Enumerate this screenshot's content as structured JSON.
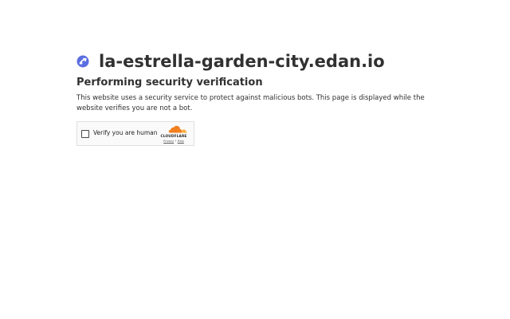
{
  "site": {
    "name": "la-estrella-garden-city.edan.io",
    "favicon_icon": "edan-logo-icon"
  },
  "main": {
    "heading": "Performing security verification",
    "description": "This website uses a security service to protect against malicious bots. This page is displayed while the website verifies you are not a bot."
  },
  "widget": {
    "checkbox_label": "Verify you are human",
    "checked": false,
    "brand": "CLOUDFLARE",
    "privacy_link": "Privacy",
    "separator": "•",
    "help_link": "Help"
  },
  "colors": {
    "text": "#313131",
    "favicon": "#5b6ee1",
    "cloudflare_orange": "#f38020",
    "cloudflare_light_orange": "#faad3f"
  }
}
